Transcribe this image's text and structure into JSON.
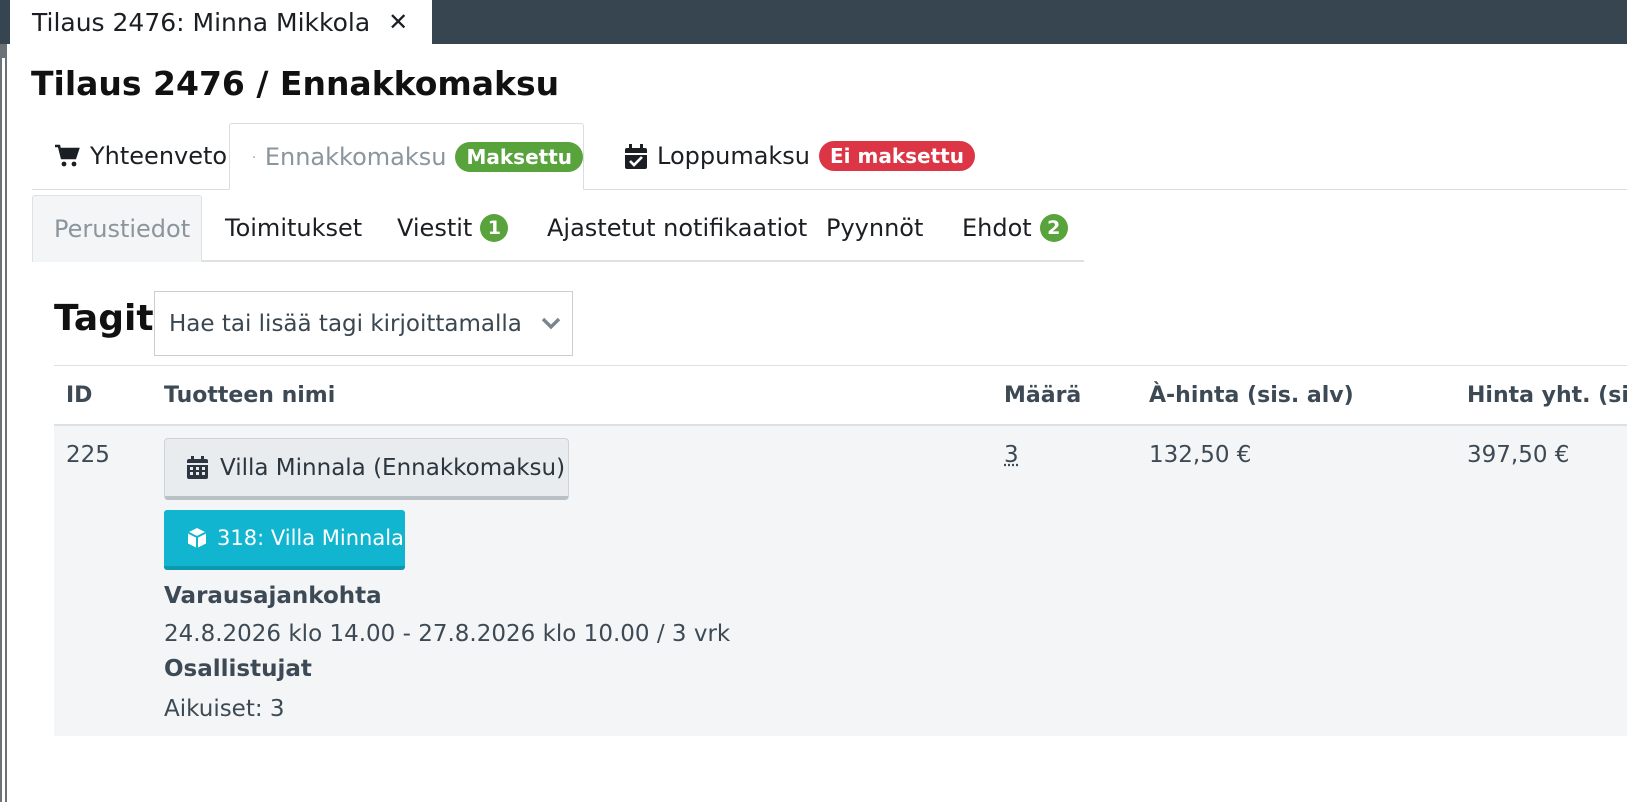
{
  "window_tab": {
    "title": "Tilaus 2476: Minna Mikkola",
    "close_glyph": "✕"
  },
  "page_title": "Tilaus 2476 / Ennakkomaksu",
  "main_tabs": [
    {
      "label": "Yhteenveto",
      "icon": "shopping-cart-icon"
    },
    {
      "label": "Ennakkomaksu",
      "icon": "credit-card-icon",
      "badge": "Maksettu",
      "badge_color": "#59a33c",
      "active": true
    },
    {
      "label": "Loppumaksu",
      "icon": "calendar-check-icon",
      "badge": "Ei maksettu",
      "badge_color": "#dc3545"
    }
  ],
  "sub_tabs": [
    {
      "label": "Perustiedot",
      "active": true
    },
    {
      "label": "Toimitukset"
    },
    {
      "label": "Viestit",
      "count": "1"
    },
    {
      "label": "Ajastetut notifikaatiot"
    },
    {
      "label": "Pyynnöt"
    },
    {
      "label": "Ehdot",
      "count": "2"
    }
  ],
  "tags": {
    "label": "Tagit",
    "placeholder": "Hae tai lisää tagi kirjoittamalla"
  },
  "table": {
    "headers": [
      "ID",
      "Tuotteen nimi",
      "Määrä",
      "À-hinta (sis. alv)",
      "Hinta yht. (sis. alv)"
    ],
    "row": {
      "id": "225",
      "product_button": "Villa Minnala (Ennakkomaksu)",
      "linked_product": "318: Villa Minnala",
      "reservation_label": "Varausajankohta",
      "reservation_value": "24.8.2026 klo 14.00 - 27.8.2026 klo 10.00 / 3 vrk",
      "participants_label": "Osallistujat",
      "participants_value": "Aikuiset: 3",
      "quantity": "3",
      "unit_price": "132,50 €",
      "total_price": "397,50 €"
    }
  },
  "colors": {
    "topbar": "#374551",
    "green_badge": "#59a33c",
    "red_badge": "#dc3545",
    "cyan_button": "#12b5cf"
  }
}
